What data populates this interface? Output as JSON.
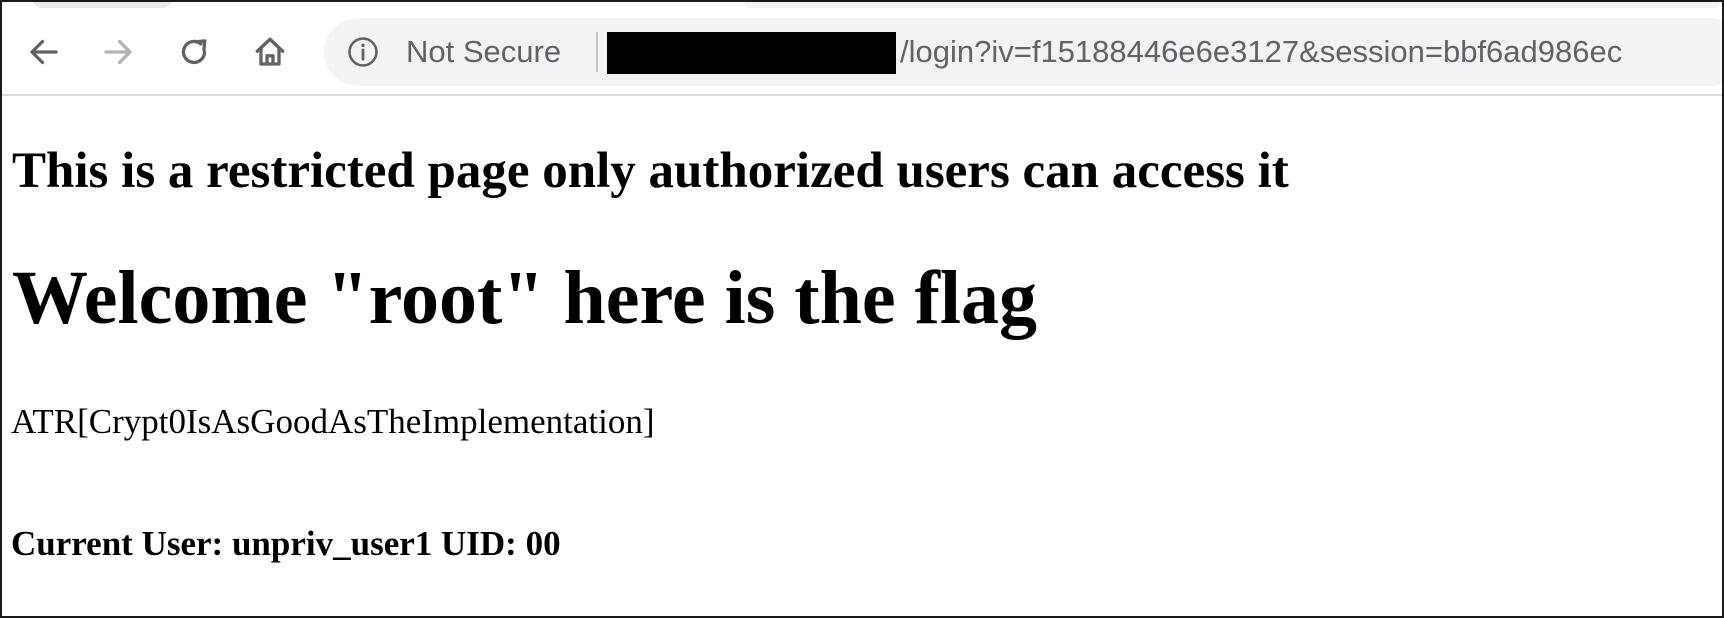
{
  "browser": {
    "nav": {
      "back_icon": "arrow-left-icon",
      "forward_icon": "arrow-right-icon",
      "reload_icon": "reload-icon",
      "home_icon": "home-icon"
    },
    "omnibox": {
      "security_icon": "info-circle-icon",
      "security_label": "Not Secure",
      "url_path": "/login?iv=f15188446e6e3127&session=bbf6ad986ec",
      "host_redacted": true
    },
    "colors": {
      "toolbar_icon": "#5f6368",
      "toolbar_icon_disabled": "#b0b3b8",
      "omnibox_bg": "#f1f3f4",
      "redaction": "#000000"
    }
  },
  "page": {
    "heading_restricted": "This is a restricted page only authorized users can access it",
    "heading_welcome": "Welcome \"root\" here is the flag",
    "flag": "ATR[Crypt0IsAsGoodAsTheImplementation]",
    "current_user": "Current User: unpriv_user1 UID: 00"
  }
}
